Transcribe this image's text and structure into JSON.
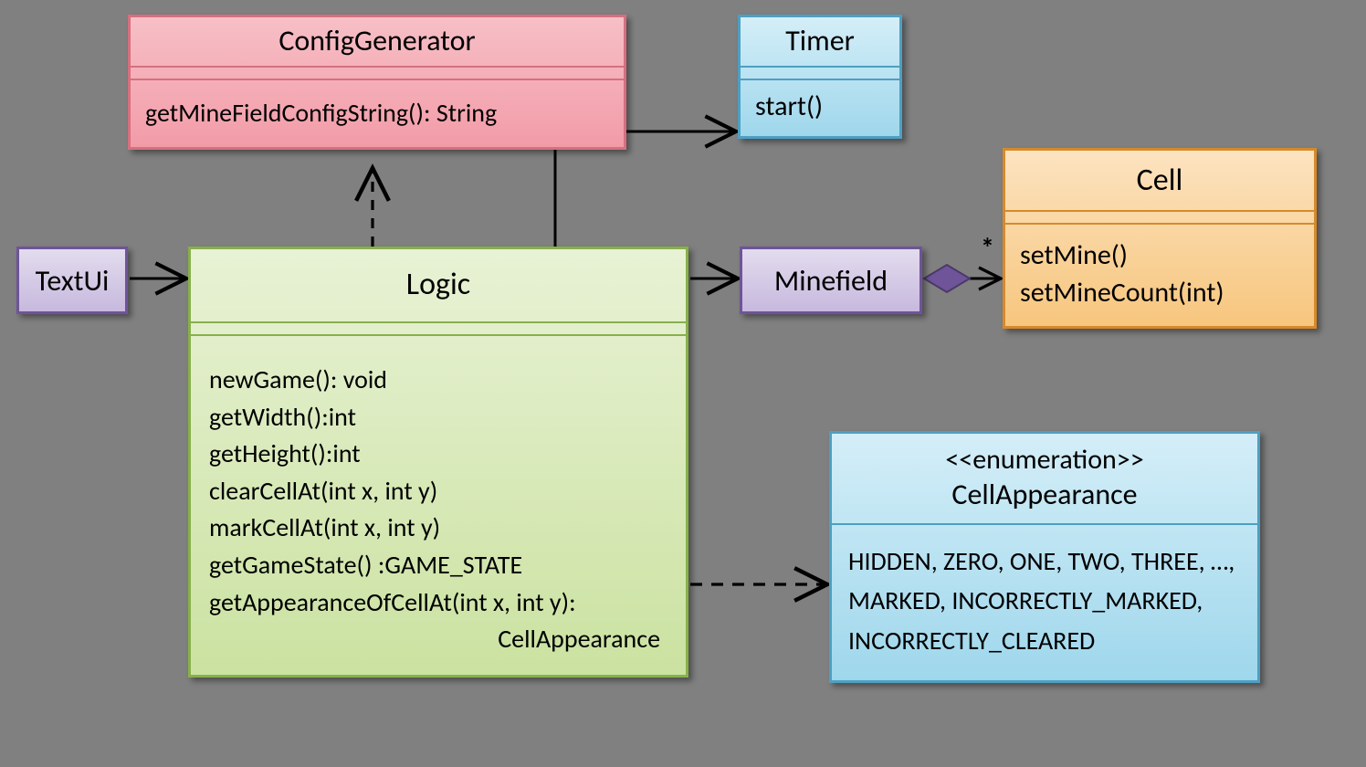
{
  "classes": {
    "configGenerator": {
      "name": "ConfigGenerator",
      "methods": [
        "getMineFieldConfigString(): String"
      ]
    },
    "timer": {
      "name": "Timer",
      "methods": [
        "start()"
      ]
    },
    "textUi": {
      "name": "TextUi"
    },
    "logic": {
      "name": "Logic",
      "methods": [
        "newGame(): void",
        "getWidth():int",
        "getHeight():int",
        "clearCellAt(int x, int y)",
        "markCellAt(int x, int y)",
        "getGameState() :GAME_STATE",
        "getAppearanceOfCellAt(int x, int y):"
      ],
      "methodsTail": "CellAppearance"
    },
    "minefield": {
      "name": "Minefield"
    },
    "cell": {
      "name": "Cell",
      "methods": [
        "setMine()",
        "setMineCount(int)"
      ]
    },
    "cellAppearance": {
      "stereotype": "<<enumeration>>",
      "name": "CellAppearance",
      "literals": "HIDDEN, ZERO, ONE, TWO, THREE, …, MARKED, INCORRECTLY_MARKED, INCORRECTLY_CLEARED"
    }
  },
  "multiplicity": {
    "cell": "*"
  },
  "colors": {
    "pink_border": "#D6707F",
    "pink_fill_top": "#F7BFC6",
    "pink_fill_bot": "#F29CA8",
    "blue_border": "#4E9FC2",
    "blue_fill_top": "#D4EEF8",
    "blue_fill_bot": "#9FD7EC",
    "purple_border": "#6F5499",
    "purple_fill_top": "#E3DCEE",
    "purple_fill_bot": "#C7B9DE",
    "green_border": "#88B04B",
    "green_fill_top": "#E8F2D5",
    "green_fill_bot": "#CBE2A1",
    "orange_border": "#D68A2B",
    "orange_fill_top": "#FCE3C0",
    "orange_fill_bot": "#F7C67E"
  }
}
